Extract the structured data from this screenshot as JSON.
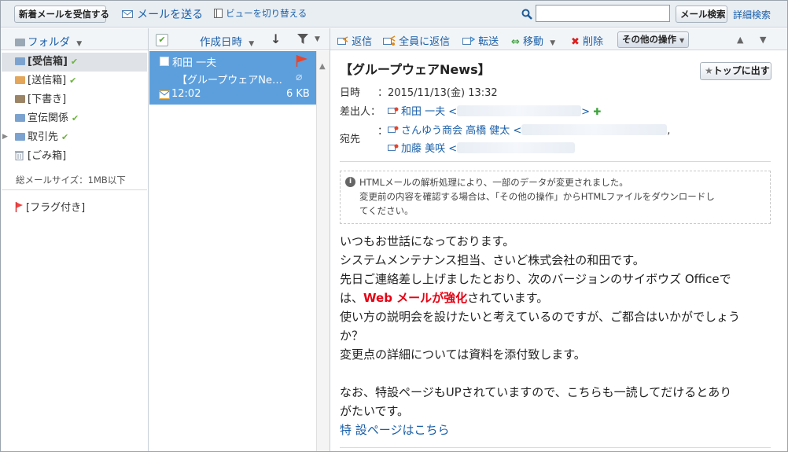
{
  "toolbar": {
    "receive_button": "新着メールを受信する",
    "send_mail": "メールを送る",
    "switch_view": "ビューを切り替える",
    "search_placeholder": "",
    "search_button": "メール検索",
    "advanced_search": "詳細検索"
  },
  "folders": {
    "header": "フォルダ",
    "items": [
      {
        "label": "[受信箱]",
        "checked": true,
        "icon": "inbox-folder-icon",
        "color": "#7ca3cf"
      },
      {
        "label": "[送信箱]",
        "checked": true,
        "icon": "sent-folder-icon",
        "color": "#e3a65a"
      },
      {
        "label": "[下書き]",
        "checked": false,
        "icon": "draft-folder-icon",
        "color": "#9c8466"
      },
      {
        "label": "宣伝関係",
        "checked": true,
        "icon": "folder-icon",
        "color": "#7ca3cf"
      },
      {
        "label": "取引先",
        "checked": true,
        "icon": "folder-icon",
        "color": "#7ca3cf"
      },
      {
        "label": "[ごみ箱]",
        "checked": false,
        "icon": "trash-icon",
        "color": "#8d9aa8"
      }
    ],
    "total_size": "総メールサイズ：1MB以下",
    "flagged": "[フラグ付き]"
  },
  "list": {
    "sort_label": "作成日時",
    "mail": {
      "sender": "和田 一夫",
      "subject": "【グループウェアNe…",
      "time": "12:02",
      "size": "6 KB"
    }
  },
  "actions": {
    "reply": "返信",
    "reply_all": "全員に返信",
    "forward": "転送",
    "move": "移動",
    "delete": "削除",
    "more": "その他の操作"
  },
  "mail": {
    "title": "【グループウェアNews】",
    "pin_button": "トップに出す",
    "date_label": "日時",
    "date_value": "：2015/11/13(金) 13:32",
    "from_label": "差出人：",
    "from_name": "和田 一夫 <",
    "to_label": "宛先",
    "to_colon": "：",
    "to1": "さんゆう商会 高橋 健太 <",
    "to2": "加藤 美咲 <",
    "notice_line1": "HTMLメールの解析処理により、一部のデータが変更されました。",
    "notice_line2": "変更前の内容を確認する場合は、「その他の操作」からHTMLファイルをダウンロードし",
    "notice_line3": "てください。",
    "body1": "いつもお世話になっております。",
    "body2": "システムメンテナンス担当、さいど株式会社の和田です。",
    "body3": "先日ご連絡差し上げましたとおり、次のバージョンのサイボウズ Officeで",
    "body4_pre": "は、",
    "body4_hl": "Web メールが強化",
    "body4_post": "されています。",
    "body5": "使い方の説明会を設けたいと考えているのですが、ご都合はいかがでしょう",
    "body6": "か？",
    "body7": "変更点の詳細については資料を添付致します。",
    "body8": "なお、特設ページもUPされていますので、こちらも一読してだけるとあり",
    "body9": "がたいです。",
    "link": "特 設ページはこちら",
    "highlight_color": "#e60012"
  }
}
